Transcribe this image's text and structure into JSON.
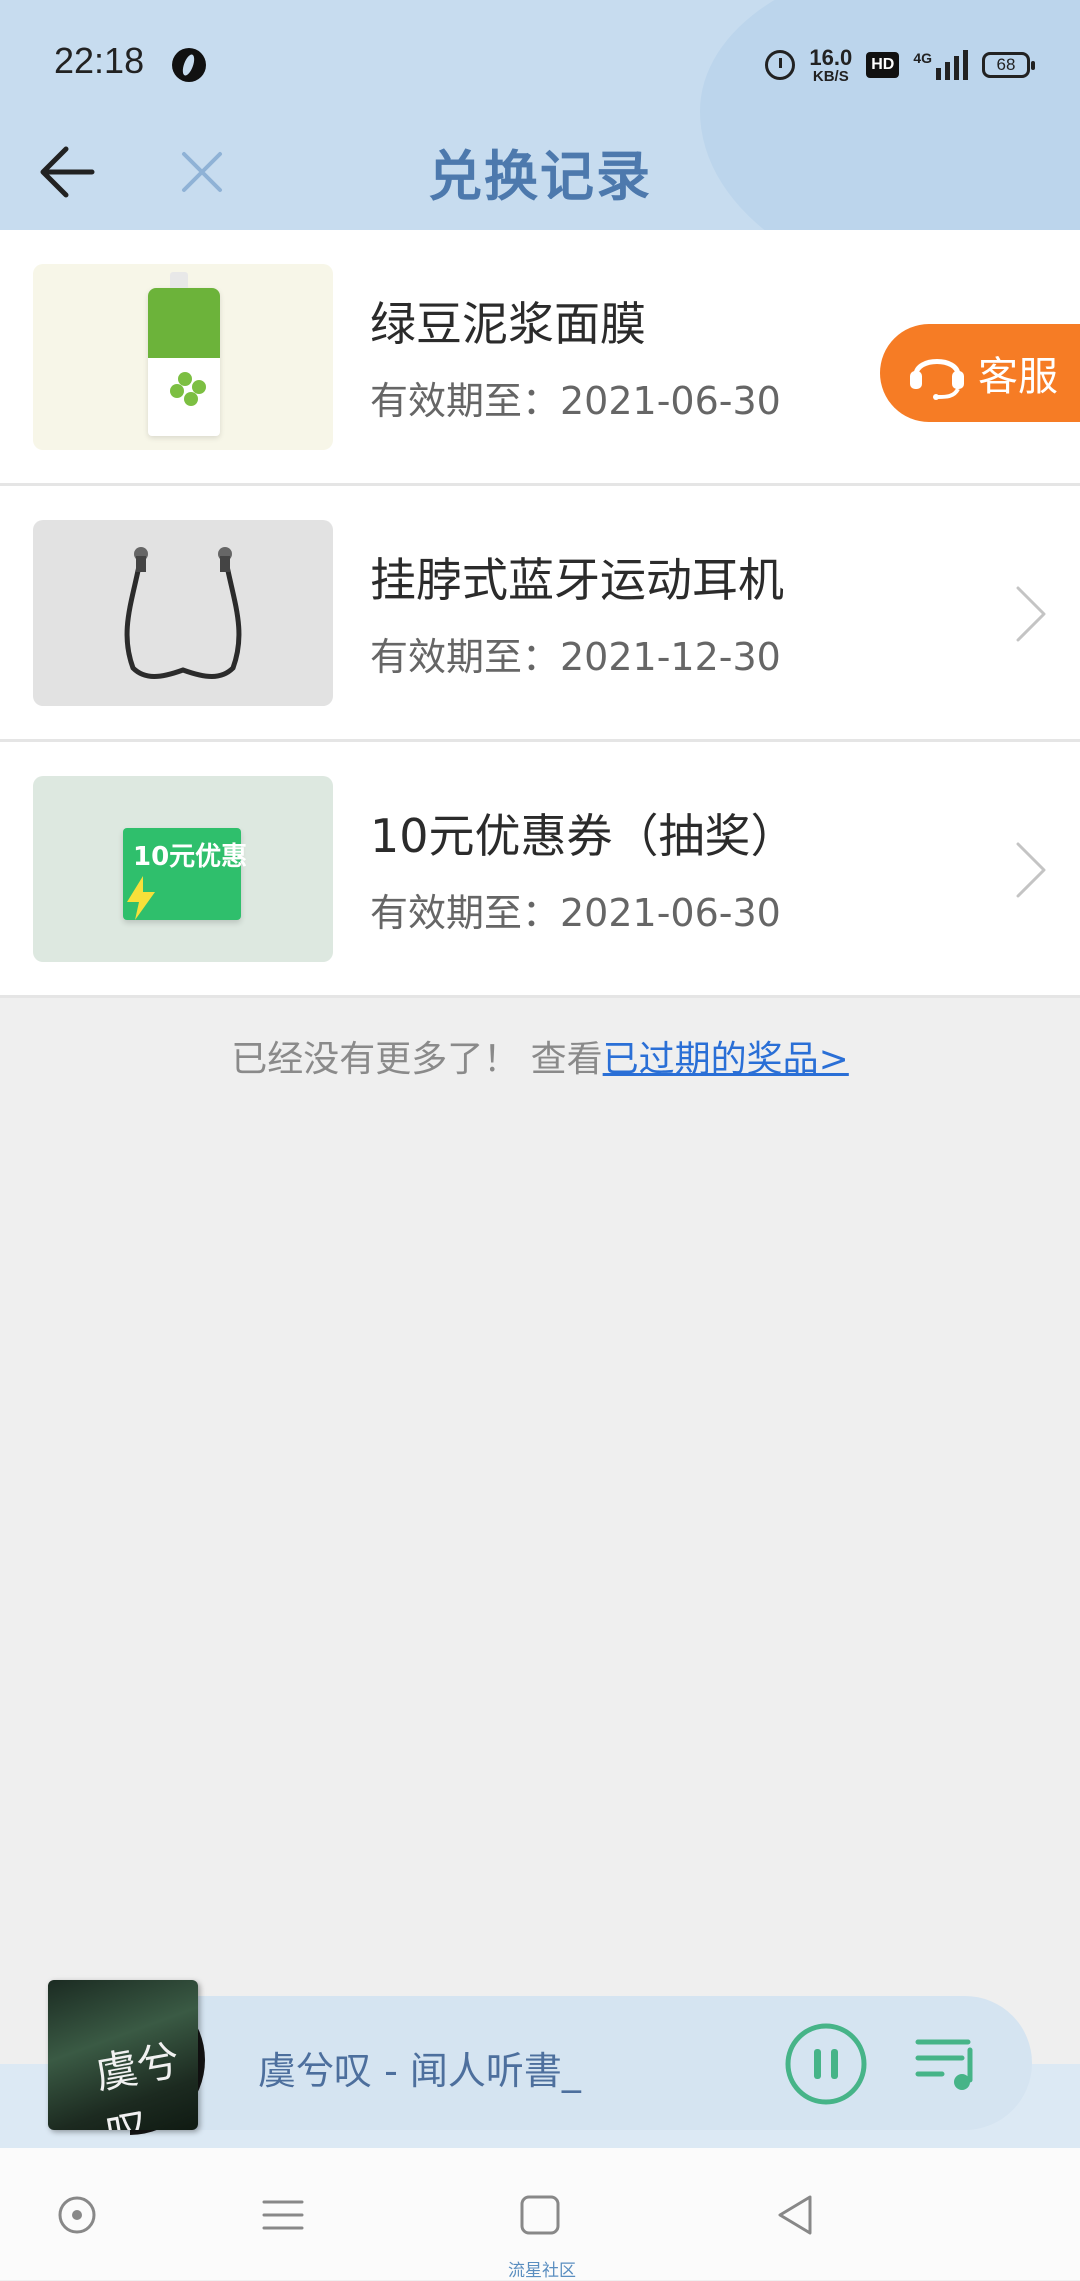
{
  "status_bar": {
    "time": "22:18",
    "net_speed_value": "16.0",
    "net_speed_unit": "KB/S",
    "hd_label": "HD",
    "network_label": "4G",
    "battery_level": "68",
    "icons": [
      "alarm-icon",
      "hd-icon",
      "signal-icon",
      "battery-icon"
    ]
  },
  "header": {
    "title": "兑换记录",
    "back_icon": "back-arrow-icon",
    "close_icon": "close-icon",
    "title_color": "#4d79ad"
  },
  "items": [
    {
      "name": "绿豆泥浆面膜",
      "expiry": "有效期至：2021-06-30"
    },
    {
      "name": "挂脖式蓝牙运动耳机",
      "expiry": "有效期至：2021-12-30"
    },
    {
      "name": "10元优惠券（抽奖）",
      "expiry": "有效期至：2021-06-30",
      "thumb_text": "10元优惠"
    }
  ],
  "service_button": {
    "label": "客服",
    "color": "#f67c25"
  },
  "end_hint": {
    "text": "已经没有更多了！ 查看",
    "link": "已过期的奖品>"
  },
  "player": {
    "track": "虞兮叹 - 闻人听書_",
    "cover_text": "虞兮叹"
  },
  "nav": {
    "icons": [
      "circle-nav-icon",
      "menu-nav-icon",
      "home-nav-icon",
      "back-nav-icon"
    ]
  },
  "watermark": "流星社区"
}
